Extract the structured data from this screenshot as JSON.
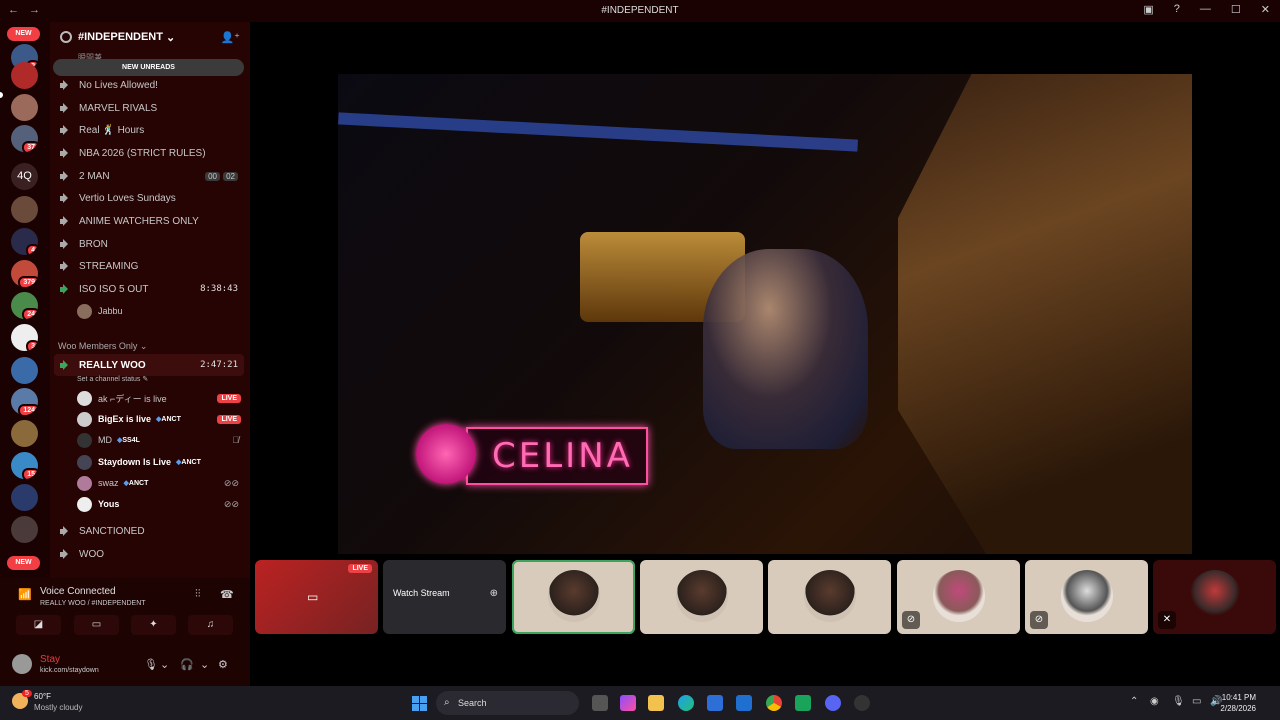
{
  "window": {
    "title": "#INDEPENDENT"
  },
  "server": {
    "name": "#INDEPENDENT",
    "new_unreads": "NEW UNREADS",
    "hidden_channel_fragment": "瞬間兼"
  },
  "server_list": {
    "new_label": "NEW",
    "badges": [
      "2",
      "37",
      "4",
      "379",
      "24",
      "3",
      "124",
      "15"
    ],
    "folder_label": "4Q"
  },
  "channels": [
    {
      "name": "No Lives Allowed!"
    },
    {
      "name": "MARVEL RIVALS"
    },
    {
      "name": "Real 🕺 Hours"
    },
    {
      "name": "NBA 2026 (STRICT RULES)"
    },
    {
      "name": "2 MAN",
      "count_a": "00",
      "count_b": "02"
    },
    {
      "name": "Vertio Loves Sundays"
    },
    {
      "name": "ANIME WATCHERS ONLY"
    },
    {
      "name": "BRON"
    },
    {
      "name": "STREAMING"
    },
    {
      "name": "ISO ISO 5 OUT",
      "time": "8:38:43"
    }
  ],
  "iso_member": "Jabbu",
  "category": "Woo Members Only",
  "active_channel": {
    "name": "REALLY WOO",
    "time": "2:47:21",
    "status_placeholder": "Set a channel status"
  },
  "members": [
    {
      "name": "ak ⌐ディー is live",
      "live": "LIVE"
    },
    {
      "name": "BigEx is live",
      "tag": "ANCT",
      "live": "LIVE"
    },
    {
      "name": "MD",
      "tag": "SS4L"
    },
    {
      "name": "Staydown Is Live",
      "tag": "ANCT"
    },
    {
      "name": "swaz",
      "tag": "ANCT"
    },
    {
      "name": "Yous"
    }
  ],
  "more_channels": [
    "SANCTIONED",
    "WOO"
  ],
  "voice": {
    "status": "Voice Connected",
    "location": "REALLY WOO / #INDEPENDENT"
  },
  "user": {
    "name": "Stay",
    "status": "kick.com/staydown"
  },
  "stream": {
    "overlay_text": "CELINA"
  },
  "tiles": {
    "live_label": "LIVE",
    "watch_label": "Watch Stream"
  },
  "taskbar": {
    "temperature": "60°F",
    "condition": "Mostly cloudy",
    "weather_badge": "5",
    "search_placeholder": "Search",
    "time": "10:41 PM",
    "date": "2/28/2026"
  }
}
